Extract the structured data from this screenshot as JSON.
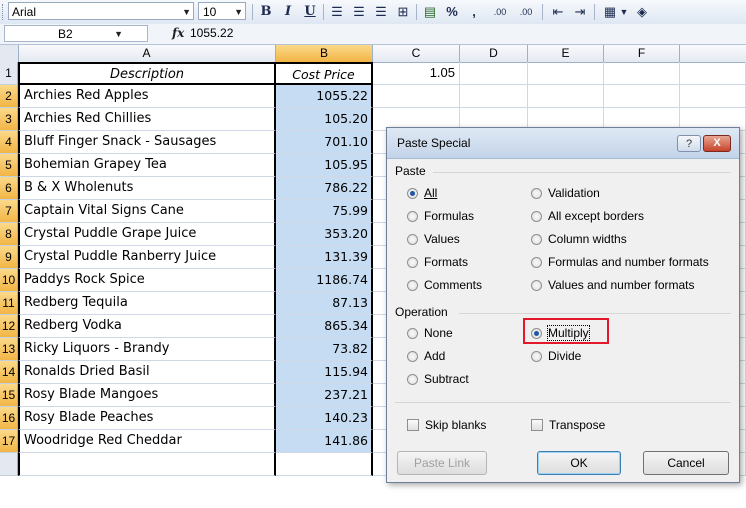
{
  "toolbar": {
    "font_name": "Arial",
    "font_size": "10",
    "bold": "B",
    "italic": "I",
    "underline": "U",
    "percent": "%",
    "comma": ",",
    "inc_decimal": ".00",
    "dec_decimal": ".00"
  },
  "formula_bar": {
    "name_box": "B2",
    "fx": "fx",
    "value": "1055.22"
  },
  "columns": [
    "A",
    "B",
    "C",
    "D",
    "E",
    "F"
  ],
  "rows": [
    {
      "num": "1",
      "a": "Description",
      "b": "Cost Price",
      "c": "1.05"
    },
    {
      "num": "2",
      "a": "Archies Red Apples",
      "b": "1055.22",
      "c": ""
    },
    {
      "num": "3",
      "a": "Archies Red Chillies",
      "b": "105.20",
      "c": ""
    },
    {
      "num": "4",
      "a": "Bluff Finger Snack - Sausages",
      "b": "701.10",
      "c": ""
    },
    {
      "num": "5",
      "a": "Bohemian Grapey Tea",
      "b": "105.95",
      "c": ""
    },
    {
      "num": "6",
      "a": "B & X Wholenuts",
      "b": "786.22",
      "c": ""
    },
    {
      "num": "7",
      "a": "Captain Vital Signs Cane",
      "b": "75.99",
      "c": ""
    },
    {
      "num": "8",
      "a": "Crystal Puddle Grape Juice",
      "b": "353.20",
      "c": ""
    },
    {
      "num": "9",
      "a": "Crystal Puddle Ranberry Juice",
      "b": "131.39",
      "c": ""
    },
    {
      "num": "10",
      "a": "Paddys Rock Spice",
      "b": "1186.74",
      "c": ""
    },
    {
      "num": "11",
      "a": "Redberg Tequila",
      "b": "87.13",
      "c": ""
    },
    {
      "num": "12",
      "a": "Redberg Vodka",
      "b": "865.34",
      "c": ""
    },
    {
      "num": "13",
      "a": "Ricky Liquors - Brandy",
      "b": "73.82",
      "c": ""
    },
    {
      "num": "14",
      "a": "Ronalds Dried Basil",
      "b": "115.94",
      "c": ""
    },
    {
      "num": "15",
      "a": "Rosy Blade Mangoes",
      "b": "237.21",
      "c": ""
    },
    {
      "num": "16",
      "a": "Rosy Blade Peaches",
      "b": "140.23",
      "c": ""
    },
    {
      "num": "17",
      "a": "Woodridge Red Cheddar",
      "b": "141.86",
      "c": ""
    }
  ],
  "dialog": {
    "title": "Paste Special",
    "help": "?",
    "close": "X",
    "paste_label": "Paste",
    "paste_left": [
      "All",
      "Formulas",
      "Values",
      "Formats",
      "Comments"
    ],
    "paste_right": [
      "Validation",
      "All except borders",
      "Column widths",
      "Formulas and number formats",
      "Values and number formats"
    ],
    "operation_label": "Operation",
    "op_left": [
      "None",
      "Add",
      "Subtract"
    ],
    "op_right": [
      "Multiply",
      "Divide"
    ],
    "skip_blanks": "Skip blanks",
    "transpose": "Transpose",
    "paste_link": "Paste Link",
    "ok": "OK",
    "cancel": "Cancel"
  }
}
